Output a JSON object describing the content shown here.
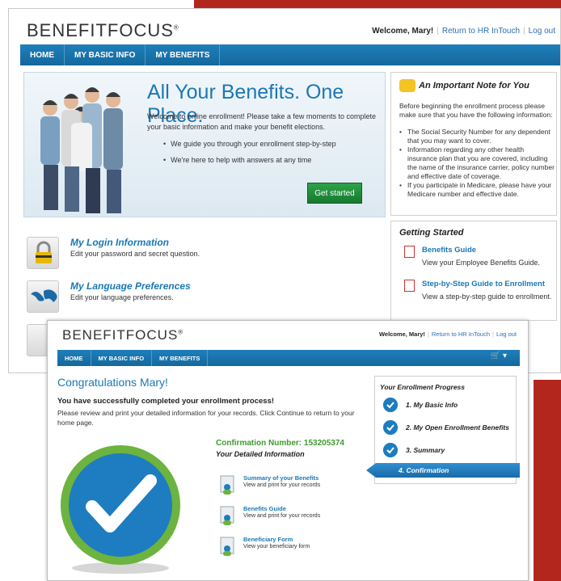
{
  "brand": {
    "logo_text": "BENEFITFOCUS",
    "logo_mark": "®"
  },
  "screen1": {
    "welcome": "Welcome, Mary!",
    "return_link": "Return to HR InTouch",
    "logout_link": "Log out",
    "nav": [
      "HOME",
      "MY BASIC INFO",
      "MY BENEFITS"
    ],
    "hero": {
      "title": "All Your Benefits. One Place.",
      "text": "Welcome to online enrollment! Please take a few moments to complete your basic information and make your benefit elections.",
      "bullets": [
        "We guide you through your enrollment step-by-step",
        "We're here to help with answers at any time"
      ],
      "cta": "Get started"
    },
    "features": [
      {
        "title": "My Login Information",
        "desc": "Edit your password and secret question."
      },
      {
        "title": "My Language Preferences",
        "desc": "Edit your language preferences."
      }
    ],
    "note": {
      "title": "An Important Note for You",
      "intro": "Before beginning the enrollment process please make sure that you have the following information:",
      "items": [
        "The Social Security Number for any dependent that you may want to cover.",
        "Information regarding any other health insurance plan that you are covered, including the name of the insurance carrier, policy number and effective date of coverage.",
        "If you participate in Medicare, please have your Medicare number and effective date."
      ]
    },
    "getting_started": {
      "title": "Getting Started",
      "items": [
        {
          "link": "Benefits Guide",
          "desc": "View your Employee Benefits Guide."
        },
        {
          "link": "Step-by-Step Guide to Enrollment",
          "desc": "View a step-by-step guide to enrollment."
        }
      ]
    }
  },
  "screen2": {
    "welcome": "Welcome, Mary!",
    "return_link": "Return to HR InTouch",
    "logout_link": "Log out",
    "nav": [
      "HOME",
      "MY BASIC INFO",
      "MY BENEFITS"
    ],
    "cart_icon": "cart-icon",
    "title": "Congratulations Mary!",
    "success": "You have successfully completed your enrollment process!",
    "review": "Please review and print your detailed information for your records. Click Continue to return to your home page.",
    "confirmation": "Confirmation Number: 153205374",
    "detail_title": "Your Detailed Information",
    "docs": [
      {
        "link": "Summary of your Benefits",
        "desc": "View and print for your records"
      },
      {
        "link": "Benefits Guide",
        "desc": "View and print for your records"
      },
      {
        "link": "Beneficiary Form",
        "desc": "View your beneficiary form"
      }
    ],
    "progress": {
      "title": "Your Enrollment Progress",
      "steps": [
        "1. My Basic Info",
        "2. My Open Enrollment Benefits",
        "3. Summary"
      ],
      "current": "4. Confirmation"
    }
  },
  "colors": {
    "accent": "#1b78b4",
    "brand_red": "#b3261e",
    "nav_blue": "#1a74ad",
    "success_green": "#3f9a2f"
  }
}
